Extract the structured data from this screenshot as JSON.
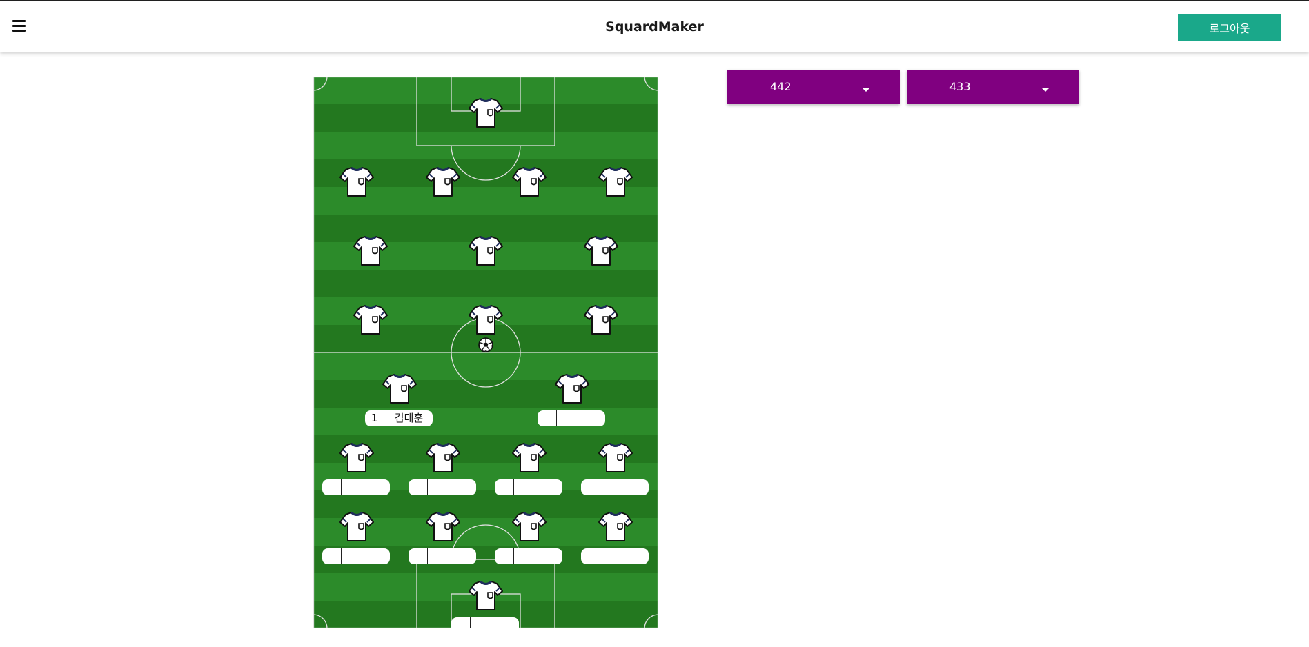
{
  "header": {
    "app_title": "SquardMaker",
    "menu_icon": "hamburger-menu-icon",
    "logout_label": "로그아웃"
  },
  "formations": {
    "home_label": "442",
    "away_label": "433",
    "dropdown_icon": "caret-down-icon",
    "button_color": "#800080"
  },
  "pitch": {
    "grass_light": "#2c8b2a",
    "grass_dark": "#23781f",
    "line_color": "#e0e0e0"
  },
  "away_team": {
    "jersey_icon": "shirt-icon",
    "players": [
      {},
      {},
      {},
      {},
      {},
      {},
      {},
      {},
      {},
      {},
      {}
    ]
  },
  "home_team": {
    "jersey_icon": "shirt-icon",
    "players": [
      {
        "number": "1",
        "name": "김태훈"
      },
      {
        "number": "",
        "name": ""
      },
      {
        "number": "",
        "name": ""
      },
      {
        "number": "",
        "name": ""
      },
      {
        "number": "",
        "name": ""
      },
      {
        "number": "",
        "name": ""
      },
      {
        "number": "",
        "name": ""
      },
      {
        "number": "",
        "name": ""
      },
      {
        "number": "",
        "name": ""
      },
      {
        "number": "",
        "name": ""
      },
      {
        "number": "",
        "name": ""
      }
    ]
  },
  "ball_icon": "soccer-ball-icon",
  "header_button_color": "#1aa88a"
}
